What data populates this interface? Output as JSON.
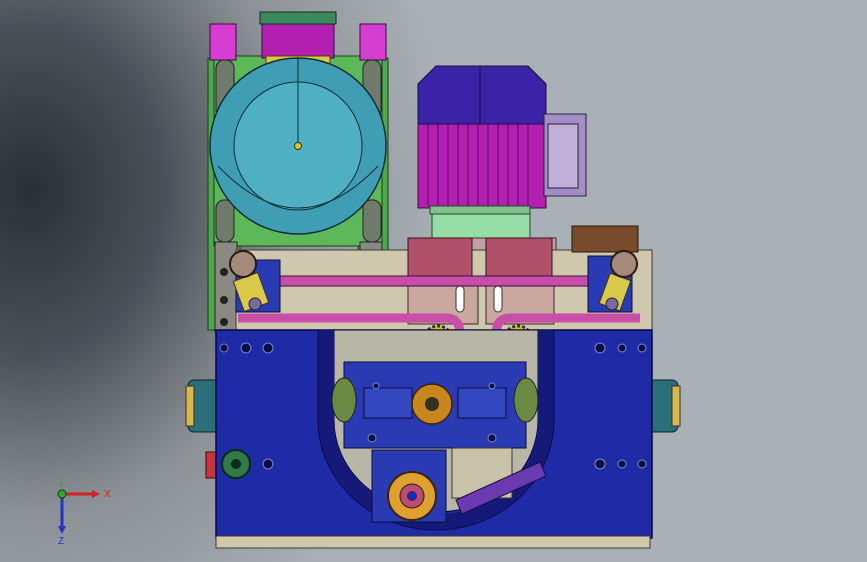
{
  "viewport": {
    "background": "#9aa1a7",
    "colors": {
      "base_blue": "#1f2aa6",
      "base_blue_dark": "#15197a",
      "motor_magenta": "#b31fb0",
      "motor_cap": "#3a23a6",
      "drum_teal": "#3f9eb3",
      "frame_green": "#4ea84e",
      "frame_grey": "#8f8f86",
      "plate_tan": "#cfc8ae",
      "gear_orange": "#c9861c",
      "link_pink": "#c94ea8",
      "block_rose": "#b0506a",
      "pink_bracket": "#d53ed0",
      "motor_base_green": "#95dca5"
    }
  },
  "triad": {
    "x_label": "X",
    "y_label": "Y",
    "z_label": "Z",
    "x_color": "#d62222",
    "y_color": "#2fa82f",
    "z_color": "#2233cc"
  }
}
